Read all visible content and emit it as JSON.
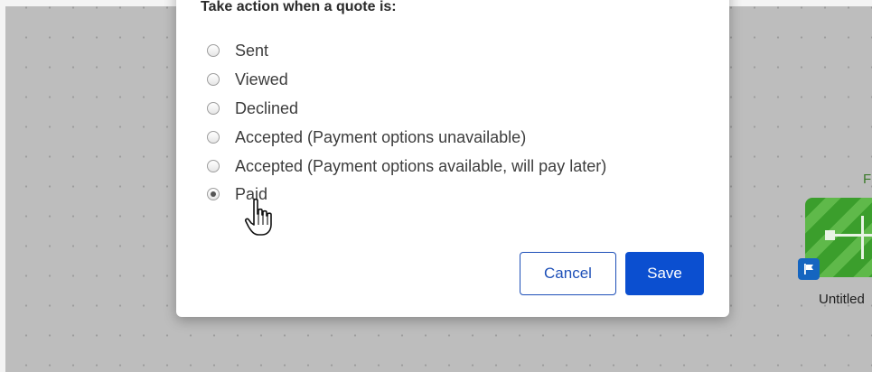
{
  "dialog": {
    "title": "Take action when a quote is:",
    "options": [
      {
        "label": "Sent",
        "checked": false
      },
      {
        "label": "Viewed",
        "checked": false
      },
      {
        "label": "Declined",
        "checked": false
      },
      {
        "label": "Accepted (Payment options unavailable)",
        "checked": false
      },
      {
        "label": "Accepted (Payment options available, will pay later)",
        "checked": false
      },
      {
        "label": "Paid",
        "checked": true
      }
    ],
    "cancel_label": "Cancel",
    "save_label": "Save"
  },
  "canvas_node": {
    "top_label": "F",
    "name": "Untitled",
    "icon": "flag-icon",
    "color": "#3b9e2c"
  },
  "colors": {
    "accent": "#0b4fd0",
    "canvas": "#bdbdbd"
  },
  "cursor": "hand-pointer-icon"
}
